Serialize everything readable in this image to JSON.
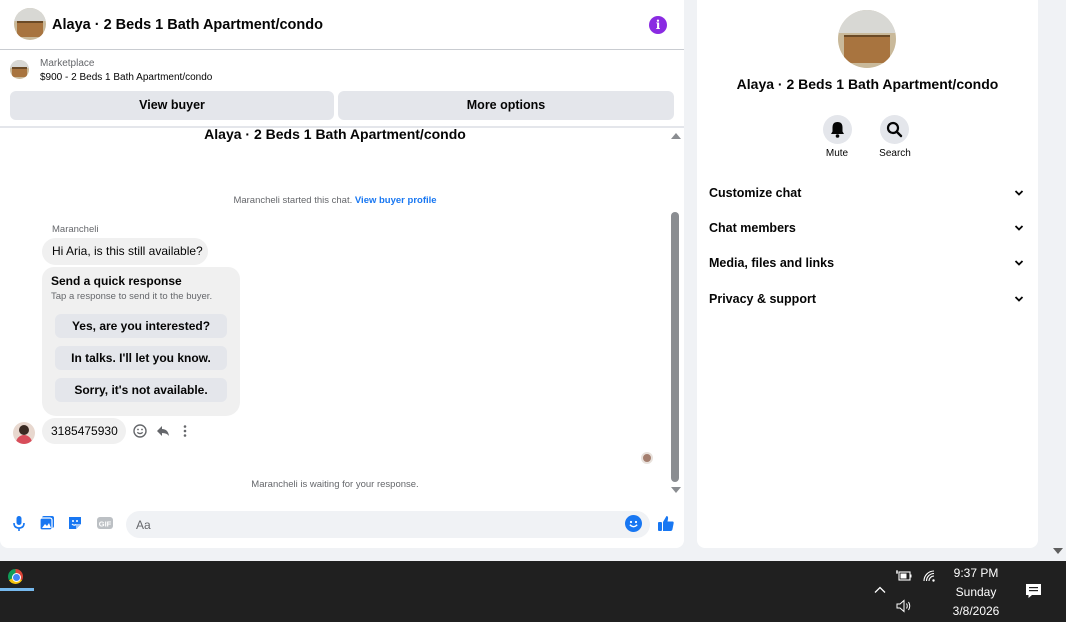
{
  "chat": {
    "title": "Alaya · 2 Beds 1 Bath Apartment/condo",
    "listing": {
      "source": "Marketplace",
      "price_title": "$900 - 2 Beds 1 Bath Apartment/condo"
    },
    "buttons": {
      "view_buyer": "View buyer",
      "more_options": "More options"
    },
    "conversation_title": "Alaya · 2 Beds 1 Bath Apartment/condo",
    "started_text": "Marancheli started this chat.",
    "view_profile_link": "View buyer profile",
    "sender_name": "Marancheli",
    "first_message": "Hi Aria, is this still available?",
    "quick_response": {
      "title": "Send a quick response",
      "subtitle": "Tap a response to send it to the buyer.",
      "options": [
        "Yes, are you interested?",
        "In talks. I'll let you know.",
        "Sorry, it's not available."
      ]
    },
    "phone_message": "3185475930",
    "waiting_text": "Marancheli is waiting for your response.",
    "composer": {
      "placeholder": "Aa",
      "icons": [
        "microphone-icon",
        "photo-icon",
        "sticker-icon",
        "gif-icon",
        "emoji-icon",
        "thumbs-up-icon"
      ]
    }
  },
  "details": {
    "title": "Alaya · 2 Beds 1 Bath Apartment/condo",
    "actions": [
      {
        "label": "Mute",
        "icon": "bell-icon"
      },
      {
        "label": "Search",
        "icon": "search-icon"
      }
    ],
    "sections": [
      "Customize chat",
      "Chat members",
      "Media, files and links",
      "Privacy & support"
    ]
  },
  "taskbar": {
    "time": "9:37 PM",
    "day": "Sunday",
    "date": "3/8/2026"
  },
  "colors": {
    "accent": "#1877f2",
    "info": "#8a2be2",
    "taskbar": "#202020"
  }
}
